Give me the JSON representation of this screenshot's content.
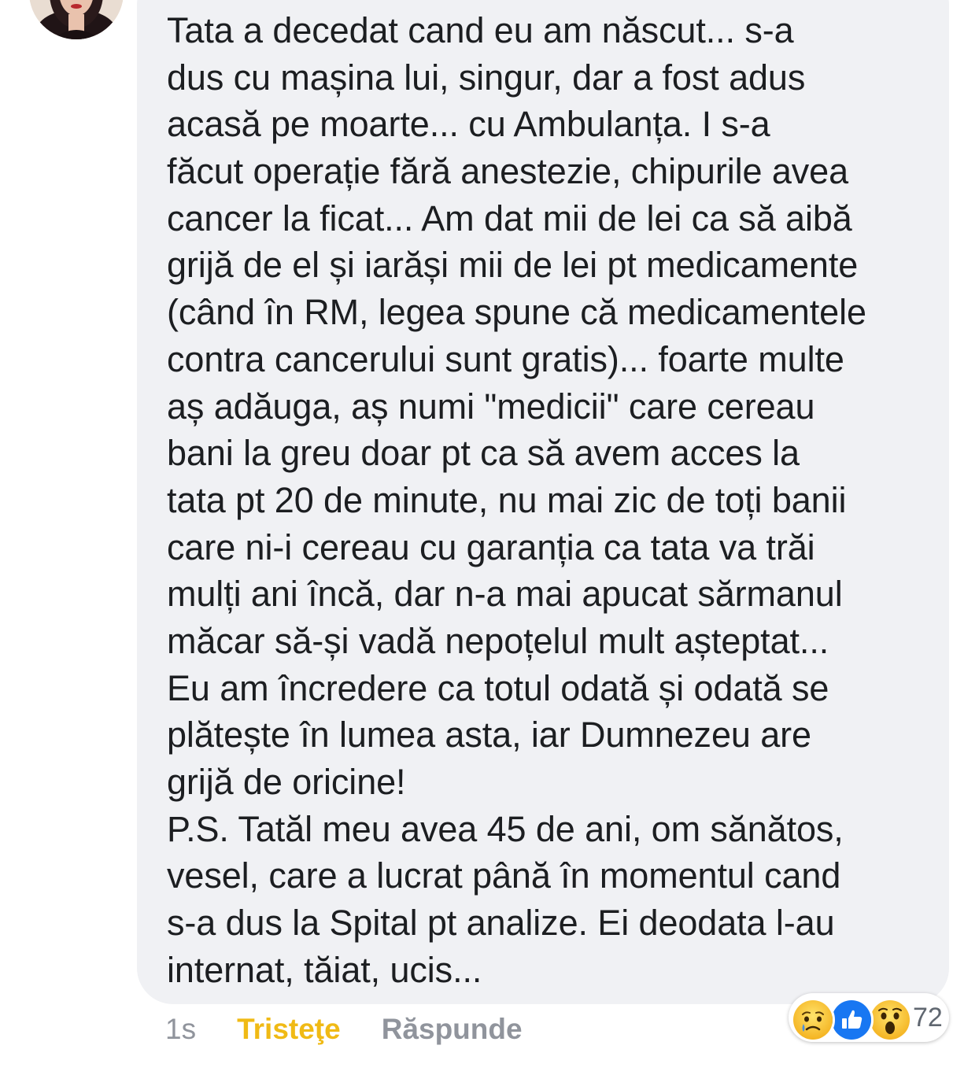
{
  "comment": {
    "lines": [
      "Tata a decedat cand eu am născut... s-a",
      "dus cu mașina lui, singur, dar a fost adus",
      "acasă pe moarte... cu Ambulanța. I s-a",
      "făcut operație fără anestezie, chipurile avea",
      "cancer la ficat... Am dat mii de lei ca să aibă",
      "grijă de el și iarăși mii de lei pt medicamente",
      "(când în RM, legea spune că medicamentele",
      "contra cancerului sunt gratis)... foarte multe",
      "aș adăuga, aș numi \"medicii\" care cereau",
      "bani la greu doar pt ca să avem acces la",
      "tata pt 20 de minute, nu mai zic de toți banii",
      "care ni-i cereau cu garanția ca tata va trăi",
      "mulți ani încă, dar n-a mai apucat sărmanul",
      "măcar să-și vadă nepoțelul mult așteptat...",
      "Eu am încredere ca totul odată și odată se",
      "plătește în lumea asta, iar Dumnezeu are",
      "grijă de oricine!",
      "P.S. Tatăl meu avea 45 de ani, om sănătos,",
      "vesel, care a lucrat până în momentul cand",
      "s-a dus la Spital pt analize. Ei deodata l-au",
      "internat, tăiat, ucis..."
    ]
  },
  "actions": {
    "time": "1s",
    "reaction_label": "Tristeţe",
    "reply_label": "Răspunde"
  },
  "reactions": {
    "icons": [
      "sad-reaction-icon",
      "like-reaction-icon",
      "wow-reaction-icon"
    ],
    "count": "72"
  },
  "colors": {
    "bubble": "#f0f1f4",
    "text": "#1c1e21",
    "muted": "#90949c",
    "sad_reaction": "#f0ba15",
    "like_blue": "#1877f2"
  }
}
